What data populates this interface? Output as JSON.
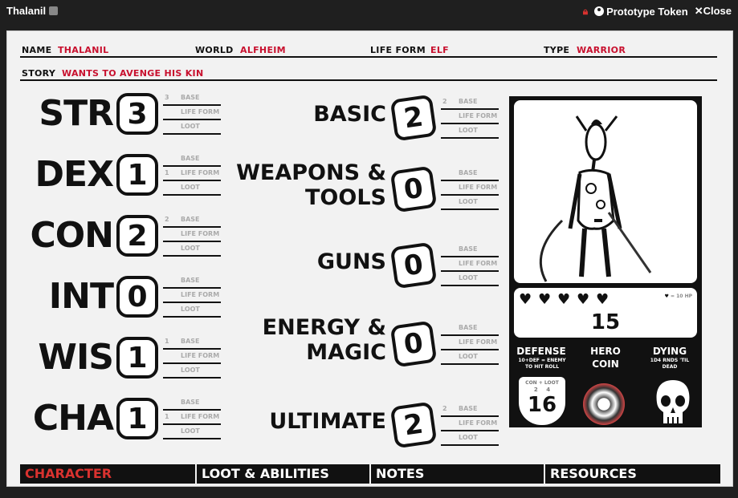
{
  "window": {
    "title": "Thalanil",
    "prototype_label": "Prototype Token",
    "close_label": "Close"
  },
  "header": {
    "name_label": "NAME",
    "name_value": "THALANIL",
    "world_label": "WORLD",
    "world_value": "ALFHEIM",
    "lifeform_label": "LIFE FORM",
    "lifeform_value": "ELF",
    "type_label": "TYPE",
    "type_value": "WARRIOR",
    "story_label": "STORY",
    "story_value": "WANTS TO AVENGE HIS KIN"
  },
  "sub_labels": {
    "base": "BASE",
    "lifeform": "LIFE FORM",
    "loot": "LOOT"
  },
  "attributes": [
    {
      "name": "STR",
      "value": "3",
      "base": "3",
      "lifeform": "",
      "loot": ""
    },
    {
      "name": "DEX",
      "value": "1",
      "base": "",
      "lifeform": "1",
      "loot": ""
    },
    {
      "name": "CON",
      "value": "2",
      "base": "2",
      "lifeform": "",
      "loot": ""
    },
    {
      "name": "INT",
      "value": "0",
      "base": "",
      "lifeform": "",
      "loot": ""
    },
    {
      "name": "WIS",
      "value": "1",
      "base": "1",
      "lifeform": "",
      "loot": ""
    },
    {
      "name": "CHA",
      "value": "1",
      "base": "",
      "lifeform": "1",
      "loot": ""
    }
  ],
  "skills": [
    {
      "line1": "BASIC",
      "line2": "",
      "value": "2",
      "base": "2",
      "lifeform": "",
      "loot": ""
    },
    {
      "line1": "WEAPONS &",
      "line2": "TOOLS",
      "value": "0",
      "base": "",
      "lifeform": "",
      "loot": ""
    },
    {
      "line1": "GUNS",
      "line2": "",
      "value": "0",
      "base": "",
      "lifeform": "",
      "loot": ""
    },
    {
      "line1": "ENERGY &",
      "line2": "MAGIC",
      "value": "0",
      "base": "",
      "lifeform": "",
      "loot": ""
    },
    {
      "line1": "ULTIMATE",
      "line2": "",
      "value": "2",
      "base": "2",
      "lifeform": "",
      "loot": ""
    }
  ],
  "hp": {
    "hearts": 5,
    "note": "= 10 HP",
    "value": "15"
  },
  "defense": {
    "title": "DEFENSE",
    "sub": "10+DEF = ENEMY TO HIT ROLL",
    "shield_label": "CON + LOOT",
    "con": "2",
    "loot": "4",
    "value": "16"
  },
  "hero_coin": {
    "title_1": "HERO",
    "title_2": "COIN"
  },
  "dying": {
    "title": "DYING",
    "sub": "1D4 RNDS 'TIL DEAD"
  },
  "tabs": [
    {
      "label": "CHARACTER",
      "active": true
    },
    {
      "label": "LOOT & ABILITIES",
      "active": false
    },
    {
      "label": "NOTES",
      "active": false
    },
    {
      "label": "RESOURCES",
      "active": false
    }
  ],
  "colors": {
    "accent": "#c8102e",
    "ink": "#111111",
    "paper": "#f2f2f2"
  }
}
